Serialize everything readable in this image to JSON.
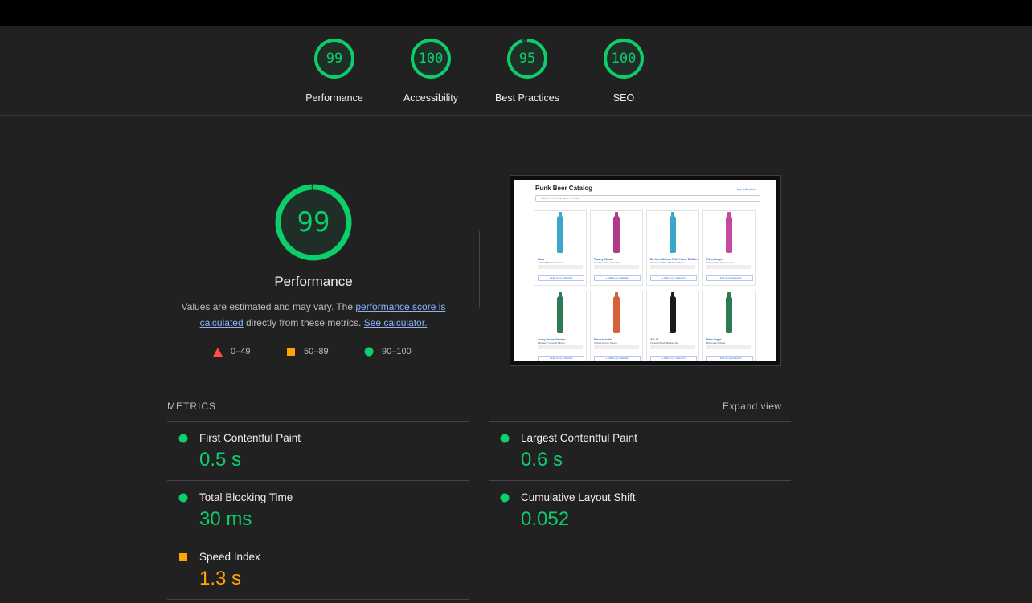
{
  "summary_gauges": [
    {
      "score": "99",
      "label": "Performance"
    },
    {
      "score": "100",
      "label": "Accessibility"
    },
    {
      "score": "95",
      "label": "Best Practices"
    },
    {
      "score": "100",
      "label": "SEO"
    }
  ],
  "performance": {
    "score": "99",
    "title": "Performance",
    "desc_prefix": "Values are estimated and may vary. The ",
    "desc_link1": "performance score is calculated",
    "desc_middle": " directly from these metrics. ",
    "desc_link2": "See calculator.",
    "legend": [
      {
        "icon": "triangle-icon",
        "range": "0–49",
        "color": "#ff4e42"
      },
      {
        "icon": "square-icon",
        "range": "50–89",
        "color": "#ffa400"
      },
      {
        "icon": "circle-icon",
        "range": "90–100",
        "color": "#0cce6b"
      }
    ]
  },
  "screenshot": {
    "title": "Punk Beer Catalog",
    "collection_link": "My collection",
    "search_placeholder": "Search beers by name or food",
    "cards": [
      {
        "name": "Buzz",
        "tag": "A Real Bitter Experience.",
        "color": "#3aa7c9"
      },
      {
        "name": "Trashy Blonde",
        "tag": "You Know You Shouldn't",
        "color": "#b03a8a"
      },
      {
        "name": "Berliner Weisse With Yuzu - B-Sides",
        "tag": "Japanese Citrus Berliner Weisse.",
        "color": "#3aa7c9"
      },
      {
        "name": "Pilsen Lager",
        "tag": "Unleash the Yeast Series.",
        "color": "#c44aa0"
      },
      {
        "name": "Avery Brown Dredge",
        "tag": "Bloggers' Imperial Pilsner.",
        "color": "#2d7a55"
      },
      {
        "name": "Electric India",
        "tag": "Vibrant Hoppy Saison.",
        "color": "#d6603a"
      },
      {
        "name": "AB:12",
        "tag": "Imperial Black Belgian Ale.",
        "color": "#1a1a1a"
      },
      {
        "name": "Fake Lager",
        "tag": "Bohemian Pilsner.",
        "color": "#2d7a55"
      }
    ],
    "add_label": "+ Add to my collection"
  },
  "metrics": {
    "heading": "METRICS",
    "expand": "Expand view",
    "left": [
      {
        "name": "First Contentful Paint",
        "value": "0.5 s",
        "status": "good"
      },
      {
        "name": "Total Blocking Time",
        "value": "30 ms",
        "status": "good"
      },
      {
        "name": "Speed Index",
        "value": "1.3 s",
        "status": "average"
      }
    ],
    "right": [
      {
        "name": "Largest Contentful Paint",
        "value": "0.6 s",
        "status": "good"
      },
      {
        "name": "Cumulative Layout Shift",
        "value": "0.052",
        "status": "good"
      }
    ]
  },
  "colors": {
    "good": "#0cce6b",
    "average": "#ffa400",
    "poor": "#ff4e42"
  }
}
